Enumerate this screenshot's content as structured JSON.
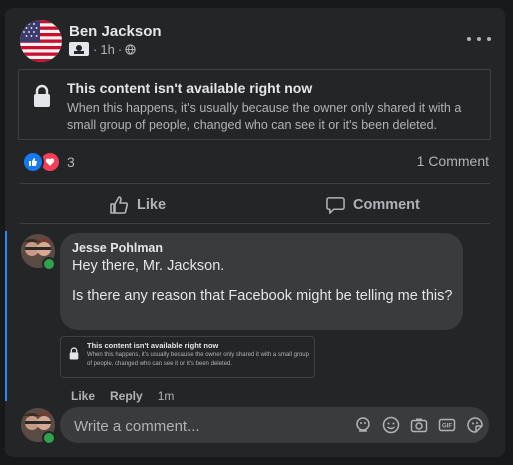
{
  "post": {
    "author": "Ben Jackson",
    "time": "1h",
    "meta_sep": "·",
    "audience_icon": "globe-icon",
    "more_icon": "more-icon"
  },
  "unavailable": {
    "title": "This content isn't available right now",
    "description": "When this happens, it's usually because the owner only shared it with a small group of people, changed who can see it or it's been deleted."
  },
  "reactions": {
    "count": "3",
    "types": [
      "like-icon",
      "love-icon"
    ],
    "comment_count": "1 Comment"
  },
  "actions": {
    "like_label": "Like",
    "comment_label": "Comment"
  },
  "comment": {
    "author": "Jesse Pohlman",
    "line1": "Hey there, Mr. Jackson.",
    "line2": "Is there any reason that Facebook might be telling me this?",
    "like_label": "Like",
    "reply_label": "Reply",
    "time": "1m",
    "attachment": {
      "title": "This content isn't available right now",
      "description": "When this happens, it's usually because the owner only shared it with a small group of people, changed who can see it or it's been deleted."
    }
  },
  "composer": {
    "placeholder": "Write a comment...",
    "tools": [
      "avatar-sticker-icon",
      "emoji-icon",
      "camera-icon",
      "gif-icon",
      "sticker-icon"
    ]
  },
  "colors": {
    "background": "#18191a",
    "card": "#242526",
    "bubble": "#3a3b3c",
    "accent": "#2d88ff",
    "like": "#1877f2",
    "love": "#f33e58",
    "online": "#31a24c"
  }
}
